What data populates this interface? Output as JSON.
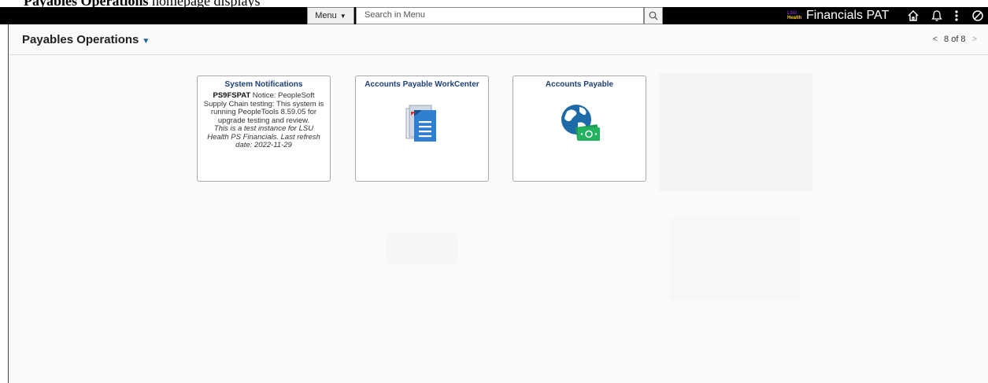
{
  "caption": {
    "bold": "Payables Operations",
    "rest": " homepage displays"
  },
  "banner": {
    "menu_label": "Menu",
    "search_placeholder": "Search in Menu",
    "logo_top": "LSU",
    "logo_bottom": "Health",
    "title": "Financials PAT",
    "icons": [
      "home-icon",
      "bell-icon",
      "more-vert-icon",
      "navbar-icon"
    ]
  },
  "page": {
    "title": "Payables Operations",
    "pager": "8 of 8"
  },
  "tiles": [
    {
      "title": "System Notifications",
      "body_bold": "PS9FSPAT",
      "body_text": " Notice: PeopleSoft Supply Chain testing: This system is running PeopleTools 8.59.05 for upgrade testing and review.",
      "body_italic": "This is a test instance for LSU Health PS Financials. Last refresh date: 2022-11-29"
    },
    {
      "title": "Accounts Payable WorkCenter",
      "icon": "document-list-icon"
    },
    {
      "title": "Accounts Payable",
      "icon": "globe-money-icon"
    }
  ],
  "colors": {
    "banner": "#000000",
    "tile_title": "#1d3f77",
    "accent": "#1f5b99"
  }
}
